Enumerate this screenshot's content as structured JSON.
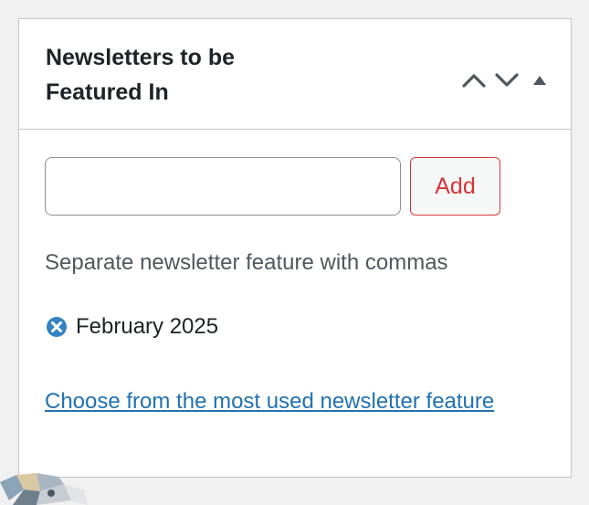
{
  "metabox": {
    "title": "Newsletters to be Featured In",
    "controls": {
      "move_up_icon": "chevron-up-icon",
      "move_down_icon": "chevron-down-icon",
      "toggle_icon": "triangle-up-icon"
    }
  },
  "tag_entry": {
    "input_value": "",
    "add_label": "Add"
  },
  "help_text": "Separate newsletter feature with commas",
  "tags": [
    {
      "label": "February 2025",
      "remove_icon": "remove-circle-icon"
    }
  ],
  "most_used_link": "Choose from the most used newsletter feature",
  "colors": {
    "accent_link": "#2271b1",
    "add_button": "#d63638",
    "remove_icon": "#3582c4"
  }
}
